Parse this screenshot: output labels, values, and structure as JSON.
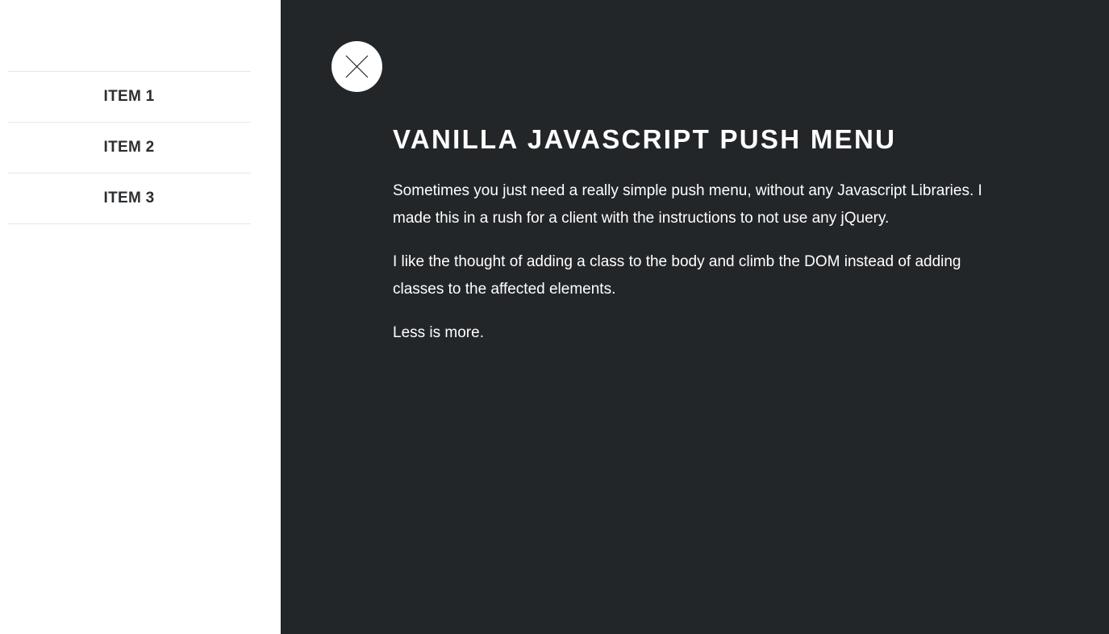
{
  "menu": {
    "items": [
      {
        "label": "ITEM 1"
      },
      {
        "label": "ITEM 2"
      },
      {
        "label": "ITEM 3"
      }
    ]
  },
  "content": {
    "close_icon": "close-icon",
    "title": "VANILLA JAVASCRIPT PUSH MENU",
    "paragraphs": [
      "Sometimes you just need a really simple push menu, without any Javascript Libraries. I made this in a rush for a client with the instructions to not use any jQuery.",
      "I like the thought of adding a class to the body and climb the DOM instead of adding classes to the affected elements.",
      "Less is more."
    ]
  },
  "colors": {
    "menu_background": "#ffffff",
    "menu_text": "#2b2e31",
    "menu_divider": "#e6e6e6",
    "content_background": "#232629",
    "content_text": "#ffffff",
    "close_button_background": "#ffffff",
    "close_icon_stroke": "#222222"
  }
}
